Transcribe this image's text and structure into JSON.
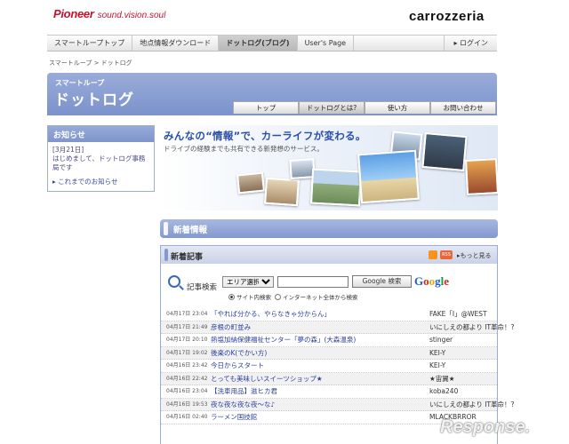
{
  "header": {
    "brand": "Pioneer",
    "tagline": "sound.vision.soul",
    "logo_right": "carrozzeria"
  },
  "topnav": {
    "items": [
      {
        "label": "スマートループトップ"
      },
      {
        "label": "地点情報ダウンロード"
      },
      {
        "label": "ドットログ(ブログ)"
      },
      {
        "label": "User's Page"
      }
    ],
    "login": "ログイン"
  },
  "breadcrumb": "スマートループ > ドットログ",
  "banner": {
    "subtitle": "スマートループ",
    "title": "ドットログ",
    "tabs": [
      {
        "label": "トップ"
      },
      {
        "label": "ドットログとは?"
      },
      {
        "label": "使い方"
      },
      {
        "label": "お問い合わせ"
      }
    ]
  },
  "notice": {
    "title": "お知らせ",
    "body_date": "[3月21日]",
    "body_text": "はじめまして、ドットログ事務局です",
    "link": "これまでのお知らせ"
  },
  "hero": {
    "headline": "みんなの“情報”で、カーライフが変わる。",
    "subline": "ドライブの経験までも共有できる新発想のサービス。"
  },
  "news": {
    "section_title": "新着情報",
    "articles_title": "新着記事",
    "more_link": "もっと見る",
    "rss_badge": "RSS",
    "search": {
      "label": "記事検索",
      "area_select": "エリア選択",
      "button": "Google 検索",
      "google_logo": "Google",
      "opt_site": "サイト内検索",
      "opt_web": "インターネット全体から検索"
    },
    "rows": [
      {
        "date": "04月17日 23:04",
        "title": "「やれば分かる、やらなきゃ分からん」",
        "author": "FAKE「I」@WEST"
      },
      {
        "date": "04月17日 21:49",
        "title": "彦根の町並み",
        "author": "いにしえの都より IT革命！?"
      },
      {
        "date": "04月17日 20:10",
        "title": "熱塩加納保健福祉センター「夢の森」(大森温泉)",
        "author": "stinger"
      },
      {
        "date": "04月17日 19:02",
        "title": "後楽のK(でかい方)",
        "author": "KEI-Y"
      },
      {
        "date": "04月16日 23:42",
        "title": "今日からスタート",
        "author": "KEI-Y"
      },
      {
        "date": "04月16日 22:42",
        "title": "とっても美味しいスイーツショップ★",
        "author": "★宙翼★"
      },
      {
        "date": "04月16日 23:04",
        "title": "【洗車用品】滋ヒカ君",
        "author": "koba240"
      },
      {
        "date": "04月16日 19:53",
        "title": "夜な夜な夜な夜～な♪",
        "author": "いにしえの都より IT革命！?"
      },
      {
        "date": "04月16日 02:40",
        "title": "ラーメン国技館",
        "author": "MLACKBRROR"
      }
    ]
  },
  "watermark": "Response."
}
